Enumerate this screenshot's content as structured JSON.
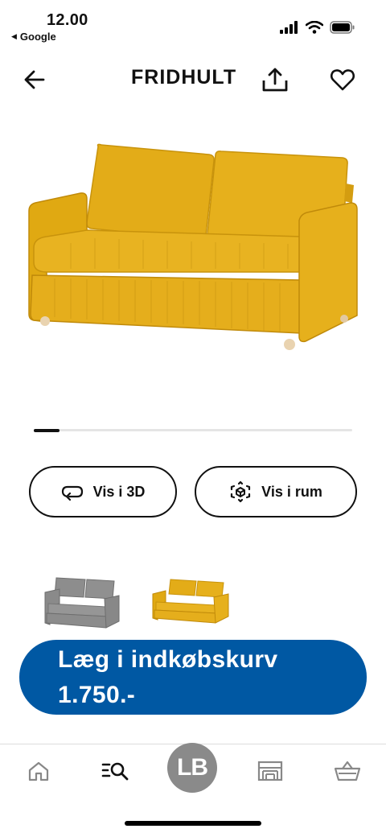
{
  "status_bar": {
    "time": "12.00",
    "back_app": "Google",
    "icons": [
      "signal-icon",
      "wifi-icon",
      "battery-icon"
    ]
  },
  "header": {
    "title": "FRIDHULT",
    "icons": [
      "back-arrow-icon",
      "share-icon",
      "heart-icon"
    ]
  },
  "product": {
    "color": "#e3b023",
    "carousel_progress": 0.08
  },
  "actions": {
    "view_3d_label": "Vis i 3D",
    "view_in_room_label": "Vis i rum"
  },
  "variants": [
    {
      "name": "grey",
      "color": "#8c8c8c"
    },
    {
      "name": "yellow",
      "color": "#e3b023",
      "selected": true
    }
  ],
  "cart": {
    "label": "Læg i indkøbskurv",
    "price": "1.750.-",
    "color": "#0058a3"
  },
  "tab_bar": {
    "avatar_initials": "LB",
    "items": [
      "home-icon",
      "search-icon",
      "avatar",
      "store-icon",
      "basket-icon"
    ]
  }
}
